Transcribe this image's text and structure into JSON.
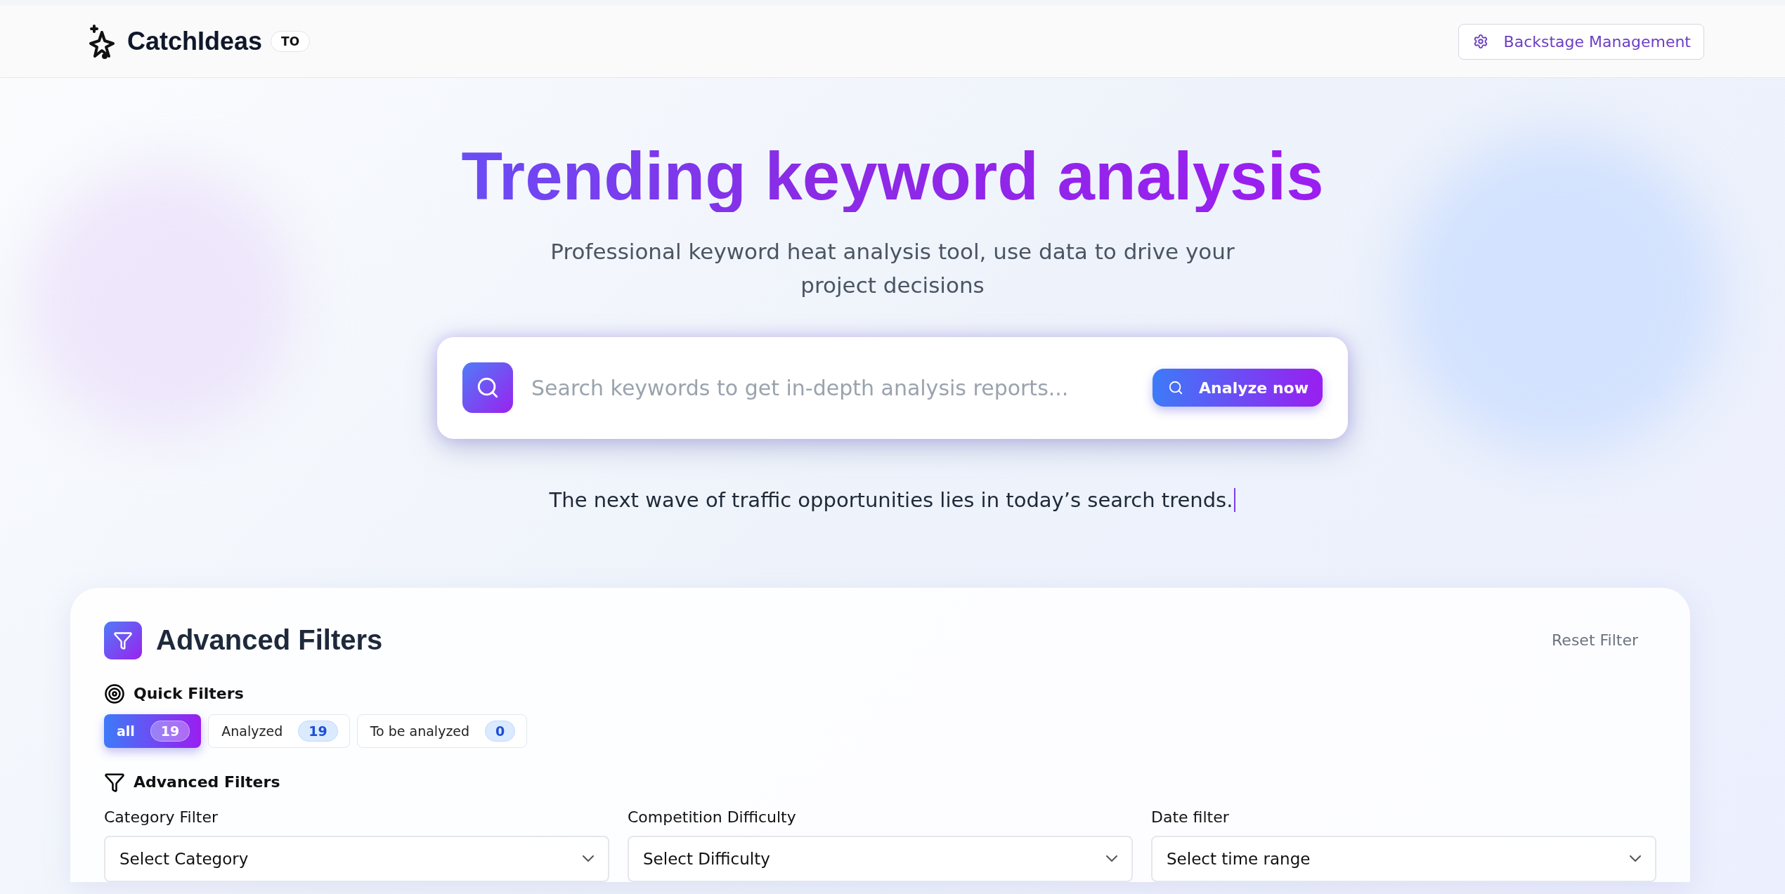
{
  "header": {
    "brand": "CatchIdeas",
    "badge": "TO",
    "admin_button": "Backstage Management"
  },
  "hero": {
    "title": "Trending keyword analysis",
    "subtitle": "Professional keyword heat analysis tool, use data to drive your project decisions",
    "search": {
      "placeholder": "Search keywords to get in-depth analysis reports...",
      "button": "Analyze now"
    },
    "tagline": "The next wave of traffic opportunities lies in today’s search trends."
  },
  "filters": {
    "title": "Advanced Filters",
    "reset": "Reset Filter",
    "quick_title": "Quick Filters",
    "quick": [
      {
        "label": "all",
        "count": "19",
        "selected": true
      },
      {
        "label": "Analyzed",
        "count": "19",
        "selected": false
      },
      {
        "label": "To be analyzed",
        "count": "0",
        "selected": false
      }
    ],
    "advanced_title": "Advanced Filters",
    "selects": [
      {
        "label": "Category Filter",
        "placeholder": "Select Category"
      },
      {
        "label": "Competition Difficulty",
        "placeholder": "Select Difficulty"
      },
      {
        "label": "Date filter",
        "placeholder": "Select time range"
      }
    ]
  }
}
